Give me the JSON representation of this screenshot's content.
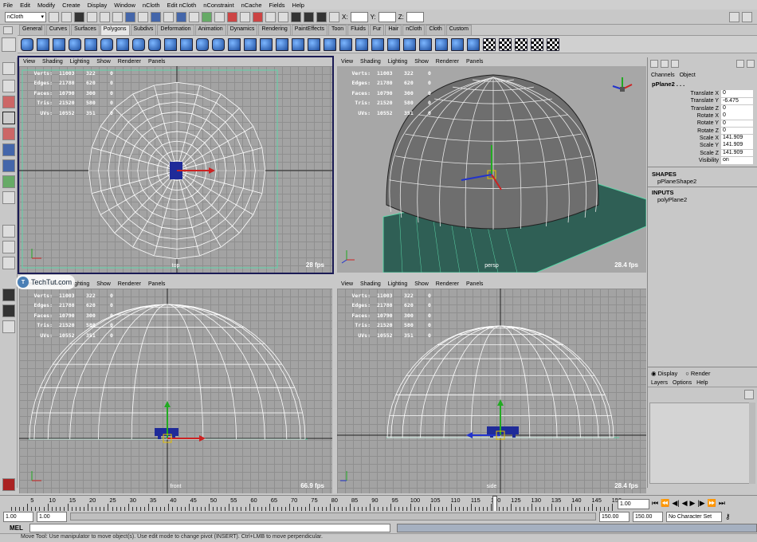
{
  "menubar": [
    "File",
    "Edit",
    "Modify",
    "Create",
    "Display",
    "Window",
    "nCloth",
    "Edit nCloth",
    "nConstraint",
    "nCache",
    "Fields",
    "Help"
  ],
  "statusline": {
    "menuset": "nCloth",
    "x_label": "X:",
    "y_label": "Y:",
    "z_label": "Z:"
  },
  "shelf": {
    "tabs": [
      "General",
      "Curves",
      "Surfaces",
      "Polygons",
      "Subdivs",
      "Deformation",
      "Animation",
      "Dynamics",
      "Rendering",
      "PaintEffects",
      "Toon",
      "Fluids",
      "Fur",
      "Hair",
      "nCloth",
      "Cloth",
      "Custom"
    ],
    "active_tab": "Polygons"
  },
  "panel_menu": [
    "View",
    "Shading",
    "Lighting",
    "Show",
    "Renderer",
    "Panels"
  ],
  "hud_labels": [
    "Verts:",
    "Edges:",
    "Faces:",
    "Tris:",
    "UVs:"
  ],
  "viewports": {
    "top": {
      "name": "top",
      "fps": "28 fps",
      "hud": [
        [
          "11003",
          "322",
          "0"
        ],
        [
          "21780",
          "620",
          "0"
        ],
        [
          "10790",
          "300",
          "0"
        ],
        [
          "21520",
          "580",
          "0"
        ],
        [
          "10552",
          "351",
          "0"
        ]
      ]
    },
    "persp": {
      "name": "persp",
      "fps": "28.4 fps",
      "hud": [
        [
          "11003",
          "322",
          "0"
        ],
        [
          "21780",
          "620",
          "0"
        ],
        [
          "10790",
          "300",
          "0"
        ],
        [
          "21520",
          "580",
          "0"
        ],
        [
          "10552",
          "351",
          "0"
        ]
      ]
    },
    "front": {
      "name": "front",
      "fps": "66.9 fps",
      "hud": [
        [
          "11003",
          "322",
          "0"
        ],
        [
          "21780",
          "620",
          "0"
        ],
        [
          "10790",
          "300",
          "0"
        ],
        [
          "21520",
          "580",
          "0"
        ],
        [
          "10552",
          "351",
          "0"
        ]
      ]
    },
    "side": {
      "name": "side",
      "fps": "28.4 fps",
      "hud": [
        [
          "11003",
          "322",
          "0"
        ],
        [
          "21780",
          "620",
          "0"
        ],
        [
          "10790",
          "300",
          "0"
        ],
        [
          "21520",
          "580",
          "0"
        ],
        [
          "10552",
          "351",
          "0"
        ]
      ]
    }
  },
  "channel_box": {
    "tabs": [
      "Channels",
      "Object"
    ],
    "object": "pPlane2 . . .",
    "attributes": [
      {
        "name": "Translate X",
        "value": "0"
      },
      {
        "name": "Translate Y",
        "value": "-6.475"
      },
      {
        "name": "Translate Z",
        "value": "0"
      },
      {
        "name": "Rotate X",
        "value": "0"
      },
      {
        "name": "Rotate Y",
        "value": "0"
      },
      {
        "name": "Rotate Z",
        "value": "0"
      },
      {
        "name": "Scale X",
        "value": "141.909"
      },
      {
        "name": "Scale Y",
        "value": "141.909"
      },
      {
        "name": "Scale Z",
        "value": "141.909"
      },
      {
        "name": "Visibility",
        "value": "on"
      }
    ],
    "shapes_label": "SHAPES",
    "shape": "pPlaneShape2",
    "inputs_label": "INPUTS",
    "input": "polyPlane2"
  },
  "layer_editor": {
    "display": "Display",
    "render": "Render",
    "menu": [
      "Layers",
      "Options",
      "Help"
    ]
  },
  "timeslider": {
    "ticks": [
      "5",
      "10",
      "15",
      "20",
      "25",
      "30",
      "35",
      "40",
      "45",
      "50",
      "55",
      "60",
      "65",
      "70",
      "75",
      "80",
      "85",
      "90",
      "95",
      "100",
      "105",
      "110",
      "115",
      "120",
      "125",
      "130",
      "135",
      "140",
      "145",
      "150"
    ],
    "current_frame": "1.00"
  },
  "range": {
    "start": "1.00",
    "inner_start": "1.00",
    "end": "150.00",
    "inner_end": "150.00",
    "character_set": "No Character Set"
  },
  "command_line": {
    "label": "MEL"
  },
  "help_line": "Move Tool: Use manipulator to move object(s). Use edit mode to change pivot (INSERT). Ctrl+LMB to move perpendicular.",
  "watermark": "TechTut.com",
  "colors": {
    "wire": "#ffffff",
    "ground": "#2f5f55",
    "grid_accent": "#5cd6a8",
    "manip_x": "#cc2222",
    "manip_y": "#22aa22",
    "manip_z": "#2233cc"
  }
}
